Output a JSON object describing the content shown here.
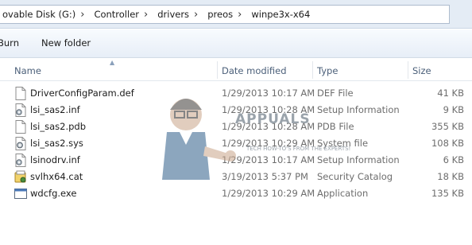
{
  "address": {
    "crumbs": [
      "ovable Disk (G:)",
      "Controller",
      "drivers",
      "preos",
      "winpe3x-x64"
    ]
  },
  "toolbar": {
    "burn_label": "Burn",
    "new_folder_label": "New folder"
  },
  "columns": {
    "name": "Name",
    "date": "Date modified",
    "type": "Type",
    "size": "Size"
  },
  "files": [
    {
      "name": "DriverConfigParam.def",
      "date": "1/29/2013 10:17 AM",
      "type": "DEF File",
      "size": "41 KB",
      "icon": "blank-file-icon"
    },
    {
      "name": "lsi_sas2.inf",
      "date": "1/29/2013 10:28 AM",
      "type": "Setup Information",
      "size": "9 KB",
      "icon": "setup-info-icon"
    },
    {
      "name": "lsi_sas2.pdb",
      "date": "1/29/2013 10:28 AM",
      "type": "PDB File",
      "size": "355 KB",
      "icon": "blank-file-icon"
    },
    {
      "name": "lsi_sas2.sys",
      "date": "1/29/2013 10:29 AM",
      "type": "System file",
      "size": "108 KB",
      "icon": "system-file-icon"
    },
    {
      "name": "lsinodrv.inf",
      "date": "1/29/2013 10:17 AM",
      "type": "Setup Information",
      "size": "6 KB",
      "icon": "setup-info-icon"
    },
    {
      "name": "svlhx64.cat",
      "date": "3/19/2013 5:37 PM",
      "type": "Security Catalog",
      "size": "18 KB",
      "icon": "security-catalog-icon"
    },
    {
      "name": "wdcfg.exe",
      "date": "1/29/2013 10:29 AM",
      "type": "Application",
      "size": "135 KB",
      "icon": "application-icon"
    }
  ],
  "watermark": {
    "brand": "APPUALS",
    "tagline": "TECH HOW-TO'S FROM THE EXPERTS!"
  }
}
